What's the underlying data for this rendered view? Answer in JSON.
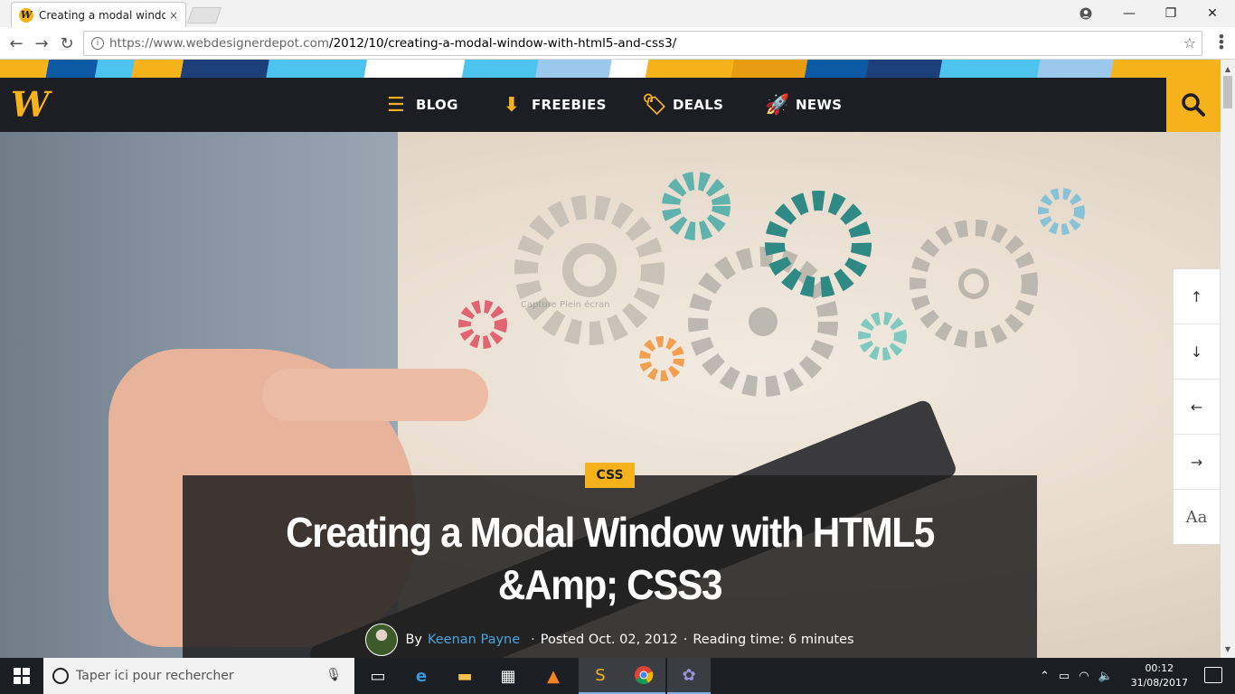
{
  "browser": {
    "tab_title": "Creating a modal window",
    "tab_close": "×",
    "favicon_letter": "W",
    "url_scheme_host": "https://www.webdesignerdepot.com",
    "url_path": "/2012/10/creating-a-modal-window-with-html5-and-css3/",
    "controls": {
      "minimize": "—",
      "maximize": "❐",
      "close": "✕"
    },
    "nav": {
      "back": "←",
      "forward": "→",
      "reload": "↻",
      "star": "☆",
      "info": "i"
    }
  },
  "site": {
    "logo_letter": "W",
    "nav_items": [
      {
        "label": "BLOG",
        "icon": "blog-list-icon",
        "glyph": "☰"
      },
      {
        "label": "FREEBIES",
        "icon": "download-icon",
        "glyph": "⬇"
      },
      {
        "label": "DEALS",
        "icon": "tag-icon",
        "glyph": "🏷"
      },
      {
        "label": "NEWS",
        "icon": "rocket-icon",
        "glyph": "🚀"
      }
    ],
    "accent_color": "#f5b21b",
    "nav_bg": "#1d1e24"
  },
  "tools": {
    "up": "↑",
    "down": "↓",
    "left": "←",
    "right": "→",
    "font": "Aa"
  },
  "article": {
    "category": "CSS",
    "title": "Creating a Modal Window with HTML5 &Amp; CSS3",
    "by": "By",
    "author": "Keenan Payne",
    "posted": "Posted Oct. 02, 2012",
    "reading_time": "Reading time: 6 minutes",
    "separator": "·"
  },
  "hero_overlay_text": "Capture Plein écran",
  "taskbar": {
    "search_placeholder": "Taper ici pour rechercher",
    "time": "00:12",
    "date": "31/08/2017",
    "apps": [
      "task-view-icon",
      "edge-icon",
      "file-explorer-icon",
      "store-icon",
      "vlc-icon",
      "sublime-icon",
      "chrome-icon",
      "app-icon"
    ]
  }
}
